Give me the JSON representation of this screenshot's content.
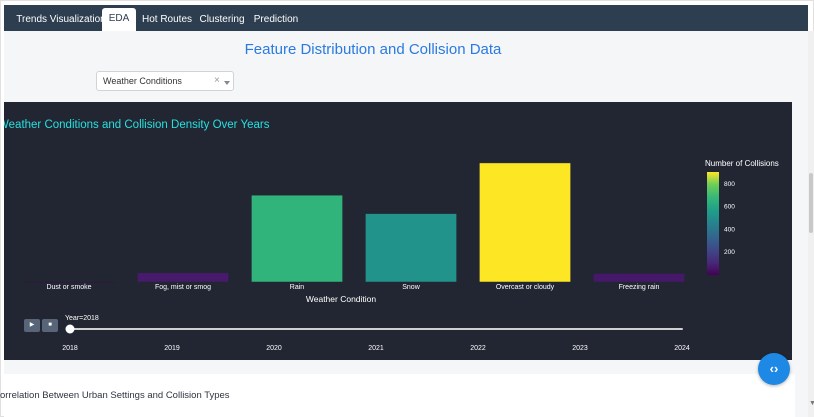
{
  "nav": {
    "tabs": [
      {
        "label": "Trends Visualization",
        "active": false
      },
      {
        "label": "EDA",
        "active": true
      },
      {
        "label": "Hot Routes",
        "active": false
      },
      {
        "label": "Clustering",
        "active": false
      },
      {
        "label": "Prediction",
        "active": false
      }
    ]
  },
  "main": {
    "title": "Feature Distribution and Collision Data",
    "dropdown": {
      "value": "Weather Conditions",
      "clear_icon": "×"
    }
  },
  "chart_data": {
    "type": "bar",
    "title": "Weather Conditions and Collision Density Over Years",
    "xlabel": "Weather Condition",
    "ylabel": "",
    "categories": [
      "Dust or smoke",
      "Fog, mist or smog",
      "Rain",
      "Snow",
      "Overcast or cloudy",
      "Freezing rain"
    ],
    "values": [
      2,
      70,
      660,
      520,
      905,
      65
    ],
    "ylim": [
      0,
      950
    ],
    "grid": false,
    "colorbar": {
      "title": "Number of Collisions",
      "ticks": [
        200,
        400,
        600,
        800
      ],
      "range": [
        0,
        905
      ]
    },
    "animation_frame": {
      "label": "Year=2018",
      "current": 2018,
      "years": [
        2018,
        2019,
        2020,
        2021,
        2022,
        2023,
        2024
      ]
    }
  },
  "lower": {
    "subtitle": "orrelation Between Urban Settings and Collision Types"
  },
  "colors": {
    "navbar": "#2c3e50",
    "title_blue": "#2a7ae2",
    "chart_bg": "#222632",
    "chart_title": "#26e0e0",
    "fab": "#1e88e5"
  },
  "icons": {
    "play": "play-icon",
    "stop": "stop-icon",
    "code": "code-icon"
  }
}
